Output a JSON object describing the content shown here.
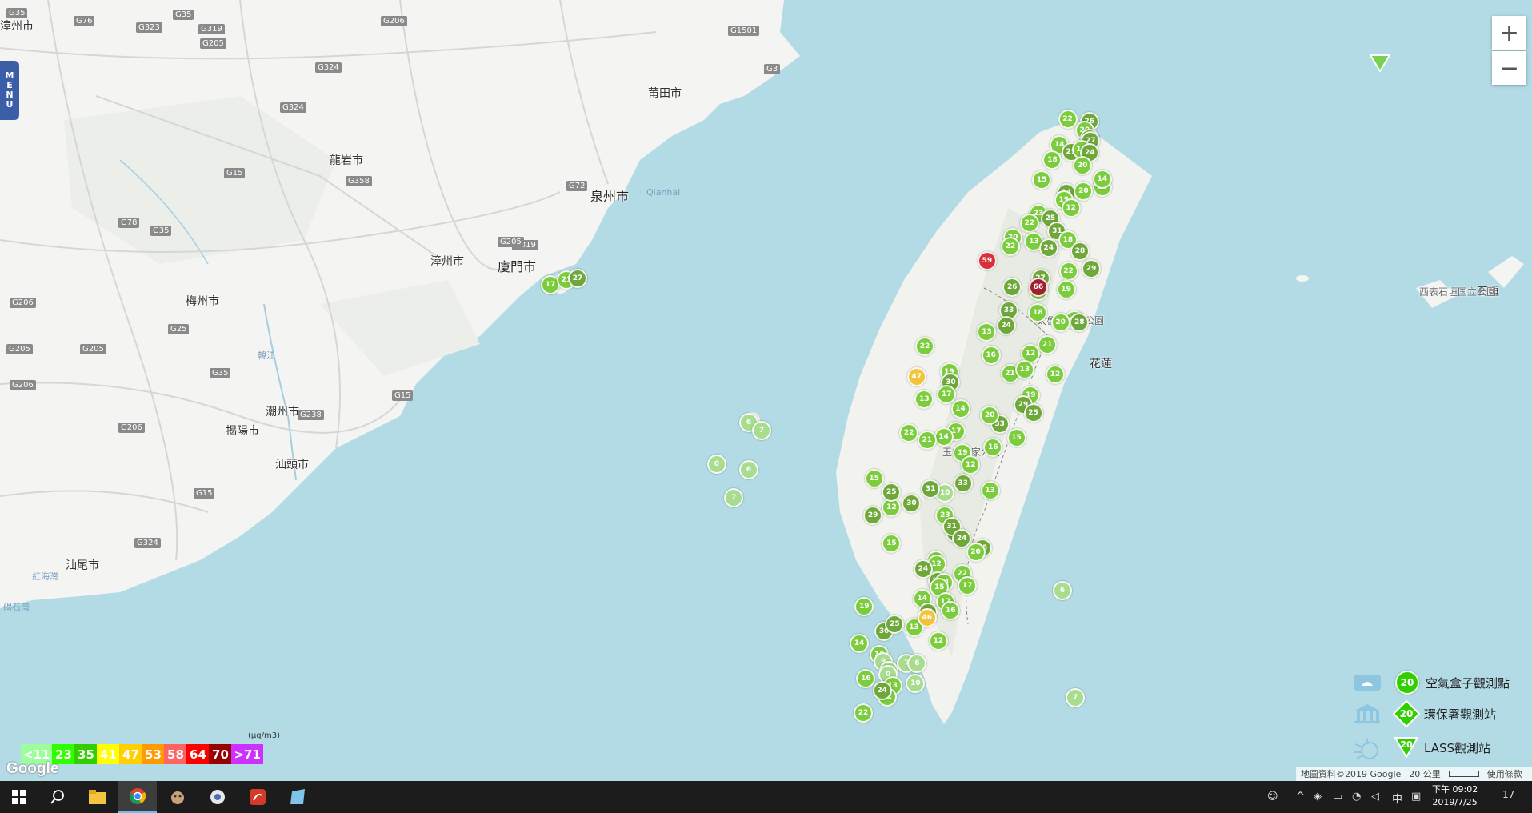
{
  "map": {
    "places": {
      "zhangzhou_top": "漳州市",
      "longyan": "龍岩市",
      "putian": "莆田市",
      "quanzhou": "泉州市",
      "qianhai": "Qianhai",
      "zhangzhou": "漳州市",
      "xiamen": "廈門市",
      "meizhou": "梅州市",
      "hanjiang": "韓江",
      "chaozhou": "潮州市",
      "jieyang": "揭陽市",
      "shantou": "汕頭市",
      "shanwei": "汕尾市",
      "bay_left1": "碣石灣",
      "bay_left2": "紅海灣",
      "taroko": "太魯閣國家公園",
      "yushan": "玉山國家公園",
      "hualien": "花蓮",
      "ishigaki": "石垣",
      "ishigaki_park": "西表石垣国立公園"
    },
    "roads": [
      "G76",
      "G323",
      "G35",
      "G319",
      "G205",
      "G206",
      "G1501",
      "G3",
      "G324",
      "G358",
      "G72",
      "G78",
      "G25",
      "G205",
      "G206",
      "G324",
      "G15",
      "G35",
      "G238",
      "G15",
      "G324",
      "G15",
      "G206",
      "G205",
      "G35",
      "G319",
      "G205",
      "G35",
      "G206"
    ],
    "markers": {
      "taiwan": [
        26,
        22,
        20,
        14,
        31,
        29,
        27,
        16,
        24,
        20,
        18,
        22,
        15,
        14,
        24,
        20,
        23,
        19,
        12,
        22,
        25,
        20,
        13,
        31,
        18,
        28,
        22,
        24,
        59,
        22,
        29,
        27,
        18,
        66,
        26,
        19,
        33,
        16,
        28,
        20,
        18,
        24,
        13,
        21,
        16,
        22,
        12,
        19,
        21,
        13,
        30,
        12,
        47,
        19,
        29,
        14,
        17,
        13,
        33,
        25,
        20,
        17,
        22,
        14,
        15,
        21,
        16,
        19,
        12,
        15,
        33,
        10,
        13,
        31,
        12,
        25,
        30,
        29,
        23,
        30,
        31,
        15,
        24,
        35,
        14,
        20,
        12,
        22,
        27,
        14,
        24,
        17,
        15,
        12,
        14,
        16,
        19,
        13,
        35,
        46,
        30,
        25,
        12,
        14,
        18,
        9,
        10,
        7,
        6,
        0,
        10,
        16,
        13,
        12,
        24,
        22
      ],
      "offshore": [
        17,
        21,
        27,
        6,
        7,
        0,
        6,
        7,
        6,
        7
      ]
    }
  },
  "legend": {
    "unit": "(μg/m3)",
    "levels": [
      {
        "label": "<11",
        "color": "#9cff9c"
      },
      {
        "label": "23",
        "color": "#31ff00"
      },
      {
        "label": "35",
        "color": "#31cf00"
      },
      {
        "label": "41",
        "color": "#ffff00"
      },
      {
        "label": "47",
        "color": "#ffcf00"
      },
      {
        "label": "53",
        "color": "#ff9a00"
      },
      {
        "label": "58",
        "color": "#ff6464"
      },
      {
        "label": "64",
        "color": "#ff0000"
      },
      {
        "label": "70",
        "color": "#990000"
      },
      {
        "label": ">71",
        "color": "#ce30ff"
      }
    ]
  },
  "types": [
    {
      "label": "空氣盒子觀測點",
      "value": "20",
      "icon": "airbox-icon"
    },
    {
      "label": "環保署觀測站",
      "value": "20",
      "icon": "epa-building-icon"
    },
    {
      "label": "LASS觀測站",
      "value": "20",
      "icon": "lass-icon"
    }
  ],
  "menu": {
    "label": "MENU"
  },
  "zoom": {
    "in": "+",
    "out": "−"
  },
  "google": {
    "logo": "Google"
  },
  "attribution": {
    "data": "地圖資料©2019 Google",
    "scale": "20 公里",
    "terms": "使用條款"
  },
  "taskbar": {
    "time": "下午 09:02",
    "date": "2019/7/25",
    "ime": "中",
    "notif": "17"
  }
}
